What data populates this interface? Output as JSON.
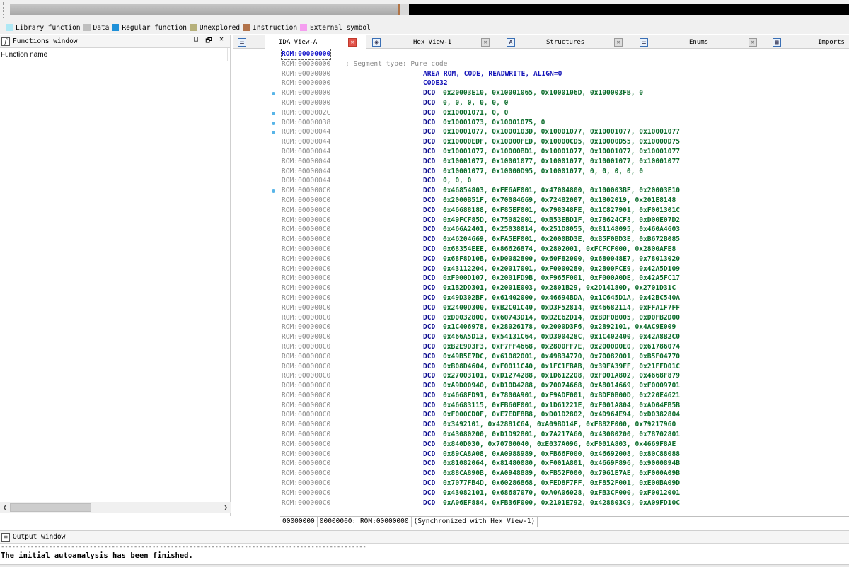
{
  "legend": [
    {
      "label": "Library function",
      "color": "#aee8f5"
    },
    {
      "label": "Data",
      "color": "#bfbfbf"
    },
    {
      "label": "Regular function",
      "color": "#1e90d8"
    },
    {
      "label": "Unexplored",
      "color": "#b6b07a"
    },
    {
      "label": "Instruction",
      "color": "#b2734a"
    },
    {
      "label": "External symbol",
      "color": "#f59ef0"
    }
  ],
  "functions_window": {
    "title": "Functions window",
    "column": "Function name",
    "buttons": [
      "□",
      "🗗",
      "✕"
    ]
  },
  "tabs": [
    {
      "label": "IDA View-A",
      "active": true
    },
    {
      "label": "Hex View-1",
      "active": false
    },
    {
      "label": "Structures",
      "active": false
    },
    {
      "label": "Enums",
      "active": false
    },
    {
      "label": "Imports",
      "active": false
    }
  ],
  "disasm": [
    {
      "addr": "ROM:00000000",
      "first": true
    },
    {
      "addr": "ROM:00000000",
      "comment": "; Segment type: Pure code"
    },
    {
      "addr": "ROM:00000000",
      "directive": "AREA ROM, CODE, READWRITE, ALIGN=0"
    },
    {
      "addr": "ROM:00000000",
      "directive": "CODE32"
    },
    {
      "addr": "ROM:00000000",
      "dot": true,
      "mnemonic": "DCD",
      "operands": "0x20003E10, 0x10001065, 0x1000106D, 0x100003FB, 0"
    },
    {
      "addr": "ROM:00000000",
      "mnemonic": "DCD",
      "operands": "0, 0, 0, 0, 0, 0"
    },
    {
      "addr": "ROM:0000002C",
      "dot": true,
      "mnemonic": "DCD",
      "operands": "0x10001071, 0, 0"
    },
    {
      "addr": "ROM:00000038",
      "dot": true,
      "mnemonic": "DCD",
      "operands": "0x10001073, 0x10001075, 0"
    },
    {
      "addr": "ROM:00000044",
      "dot": true,
      "mnemonic": "DCD",
      "operands": "0x10001077, 0x1000103D, 0x10001077, 0x10001077, 0x10001077"
    },
    {
      "addr": "ROM:00000044",
      "mnemonic": "DCD",
      "operands": "0x10000EDF, 0x10000FED, 0x10000CD5, 0x10000D55, 0x10000D75"
    },
    {
      "addr": "ROM:00000044",
      "mnemonic": "DCD",
      "operands": "0x10001077, 0x10000BD1, 0x10001077, 0x10001077, 0x10001077"
    },
    {
      "addr": "ROM:00000044",
      "mnemonic": "DCD",
      "operands": "0x10001077, 0x10001077, 0x10001077, 0x10001077, 0x10001077"
    },
    {
      "addr": "ROM:00000044",
      "mnemonic": "DCD",
      "operands": "0x10001077, 0x10000D95, 0x10001077, 0, 0, 0, 0, 0"
    },
    {
      "addr": "ROM:00000044",
      "mnemonic": "DCD",
      "operands": "0, 0, 0"
    },
    {
      "addr": "ROM:000000C0",
      "dot": true,
      "mnemonic": "DCD",
      "operands": "0x46854803, 0xFE6AF001, 0x47004800, 0x100003BF, 0x20003E10"
    },
    {
      "addr": "ROM:000000C0",
      "mnemonic": "DCD",
      "operands": "0x2000B51F, 0x70084669, 0x72482007, 0x1802019, 0x201E8148"
    },
    {
      "addr": "ROM:000000C0",
      "mnemonic": "DCD",
      "operands": "0x46688188, 0xF85EF001, 0x798348FE, 0x1C827901, 0xF001301C"
    },
    {
      "addr": "ROM:000000C0",
      "mnemonic": "DCD",
      "operands": "0x49FCF85D, 0x75082001, 0xB53EBD1F, 0x78624CF8, 0xD00E07D2"
    },
    {
      "addr": "ROM:000000C0",
      "mnemonic": "DCD",
      "operands": "0x466A2401, 0x25038014, 0x251D8055, 0x81148095, 0x460A4603"
    },
    {
      "addr": "ROM:000000C0",
      "mnemonic": "DCD",
      "operands": "0x46204669, 0xFA5EF001, 0x2000BD3E, 0xB5F0BD3E, 0xB672B085"
    },
    {
      "addr": "ROM:000000C0",
      "mnemonic": "DCD",
      "operands": "0x68354EEE, 0x86626874, 0x2802001, 0xFCFCF000, 0x2800AFE8"
    },
    {
      "addr": "ROM:000000C0",
      "mnemonic": "DCD",
      "operands": "0x68F8D10B, 0xD0082800, 0x60F82000, 0x680048E7, 0x78013020"
    },
    {
      "addr": "ROM:000000C0",
      "mnemonic": "DCD",
      "operands": "0x43112204, 0x20017001, 0xF0000280, 0x2800FCE9, 0x42A5D109"
    },
    {
      "addr": "ROM:000000C0",
      "mnemonic": "DCD",
      "operands": "0xF000D107, 0x2001FD9B, 0xF965F001, 0xF000A0DE, 0x42A5FC17"
    },
    {
      "addr": "ROM:000000C0",
      "mnemonic": "DCD",
      "operands": "0x1B2DD301, 0x2001E003, 0x2801B29, 0x2D14180D, 0x2701D31C"
    },
    {
      "addr": "ROM:000000C0",
      "mnemonic": "DCD",
      "operands": "0x49D302BF, 0x61402000, 0x46694BDA, 0x1C645D1A, 0x42BC540A"
    },
    {
      "addr": "ROM:000000C0",
      "mnemonic": "DCD",
      "operands": "0x2400D300, 0xB2C01C40, 0xD3F52814, 0x46682114, 0xFFA1F7FF"
    },
    {
      "addr": "ROM:000000C0",
      "mnemonic": "DCD",
      "operands": "0xD0032800, 0x60743D14, 0xD2E62D14, 0xBDF0B005, 0xD0FB2D00"
    },
    {
      "addr": "ROM:000000C0",
      "mnemonic": "DCD",
      "operands": "0x1C406978, 0x28026178, 0x2000D3F6, 0x2892101, 0x4AC9E009"
    },
    {
      "addr": "ROM:000000C0",
      "mnemonic": "DCD",
      "operands": "0x466A5D13, 0x54131C64, 0xD300428C, 0x1C402400, 0x42A8B2C0"
    },
    {
      "addr": "ROM:000000C0",
      "mnemonic": "DCD",
      "operands": "0xB2E9D3F3, 0xF7FF4668, 0x2800FF7E, 0x2000D0E0, 0x61786074"
    },
    {
      "addr": "ROM:000000C0",
      "mnemonic": "DCD",
      "operands": "0x49B5E7DC, 0x61082001, 0x49B34770, 0x70082001, 0xB5F04770"
    },
    {
      "addr": "ROM:000000C0",
      "mnemonic": "DCD",
      "operands": "0xB08D4604, 0xF0011C40, 0x1FC1FBAB, 0x39FA39FF, 0x21FFD01C"
    },
    {
      "addr": "ROM:000000C0",
      "mnemonic": "DCD",
      "operands": "0x27003101, 0xD1274288, 0x1D612208, 0xF001A802, 0x4668F879"
    },
    {
      "addr": "ROM:000000C0",
      "mnemonic": "DCD",
      "operands": "0xA9D00940, 0xD10D4288, 0x70074668, 0xA8014669, 0xF0009701"
    },
    {
      "addr": "ROM:000000C0",
      "mnemonic": "DCD",
      "operands": "0x4668FD91, 0x7800A901, 0xF9ADF001, 0xBDF0B00D, 0x220E4621"
    },
    {
      "addr": "ROM:000000C0",
      "mnemonic": "DCD",
      "operands": "0x46683115, 0xFB60F001, 0x1D61221E, 0xF001A804, 0xAD04FB5B"
    },
    {
      "addr": "ROM:000000C0",
      "mnemonic": "DCD",
      "operands": "0xF000CD0F, 0xE7EDF8B8, 0xD01D2802, 0x4D964E94, 0xD0382804"
    },
    {
      "addr": "ROM:000000C0",
      "mnemonic": "DCD",
      "operands": "0x3492101, 0x42881C64, 0xA09BD14F, 0xFB82F000, 0x79217960"
    },
    {
      "addr": "ROM:000000C0",
      "mnemonic": "DCD",
      "operands": "0x43080200, 0xD1D92801, 0x7A217A60, 0x43080200, 0x78702801"
    },
    {
      "addr": "ROM:000000C0",
      "mnemonic": "DCD",
      "operands": "0x840D030, 0x70700040, 0xE037A096, 0xF001A803, 0x4669F8AE"
    },
    {
      "addr": "ROM:000000C0",
      "mnemonic": "DCD",
      "operands": "0x89CA8A08, 0xA0988989, 0xFB66F000, 0x46692008, 0x80C88088"
    },
    {
      "addr": "ROM:000000C0",
      "mnemonic": "DCD",
      "operands": "0x81082064, 0x81480080, 0xF001A801, 0x4669F896, 0x9000894B"
    },
    {
      "addr": "ROM:000000C0",
      "mnemonic": "DCD",
      "operands": "0x88CA890B, 0xA0948889, 0xFB52F000, 0x7961E7AE, 0xF000A09B"
    },
    {
      "addr": "ROM:000000C0",
      "mnemonic": "DCD",
      "operands": "0x7077FB4D, 0x60286868, 0xFED8F7FF, 0xF852F001, 0xE00BA09D"
    },
    {
      "addr": "ROM:000000C0",
      "mnemonic": "DCD",
      "operands": "0x43082101, 0x68687070, 0xA0A06028, 0xFB3CF000, 0xF0012001"
    },
    {
      "addr": "ROM:000000C0",
      "mnemonic": "DCD",
      "operands": "0xA06EF884, 0xFB36F000, 0x2101E792, 0x428803C9, 0xA09FD10C"
    }
  ],
  "status": {
    "offset": "00000000",
    "location": "00000000: ROM:00000000",
    "sync": "(Synchronized with Hex View-1)"
  },
  "output_window": {
    "title": "Output window",
    "separator": "---------------------------------------------------------------------------------------------------",
    "message": "The initial autoanalysis has been finished."
  }
}
